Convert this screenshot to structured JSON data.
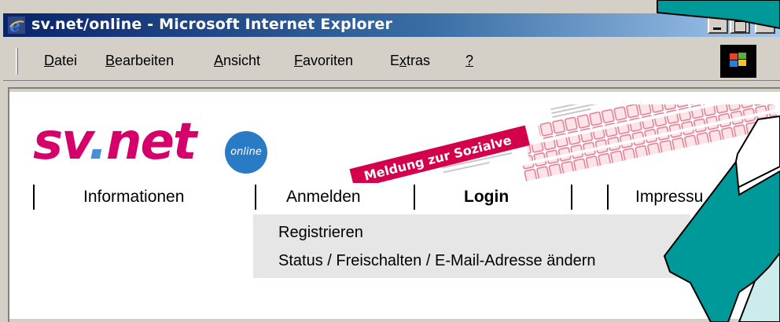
{
  "window": {
    "title": "sv.net/online - Microsoft Internet Explorer"
  },
  "menubar": {
    "items": [
      {
        "label_accel": "D",
        "label_rest": "atei"
      },
      {
        "label_accel": "B",
        "label_rest": "earbeiten"
      },
      {
        "label_accel": "A",
        "label_rest": "nsicht"
      },
      {
        "label_accel": "F",
        "label_rest": "avoriten"
      },
      {
        "label_pre": "E",
        "label_accel": "x",
        "label_rest": "tras"
      },
      {
        "label_accel": "?",
        "label_rest": ""
      }
    ]
  },
  "logo": {
    "sv": "sv",
    "dot": ".",
    "net": "net",
    "badge": "online"
  },
  "banner": {
    "ribbon_text": "Meldung zur Sozialve"
  },
  "nav": {
    "items": [
      {
        "label": "Informationen",
        "active": false
      },
      {
        "label": "Anmelden",
        "active": false
      },
      {
        "label": "Login",
        "active": true
      },
      {
        "label": "Impressu",
        "active": false
      }
    ]
  },
  "dropdown": {
    "items": [
      {
        "label": "Registrieren"
      },
      {
        "label": "Status / Freischalten / E-Mail-Adresse ändern"
      }
    ]
  },
  "colors": {
    "title_gradient_start": "#0a246a",
    "title_gradient_end": "#a6caf0",
    "logo_magenta": "#d6006b",
    "logo_blue": "#2a7bc5",
    "banner_red": "#d5004b",
    "arrow_fill": "#009999",
    "arrow_light": "#ccecec"
  }
}
